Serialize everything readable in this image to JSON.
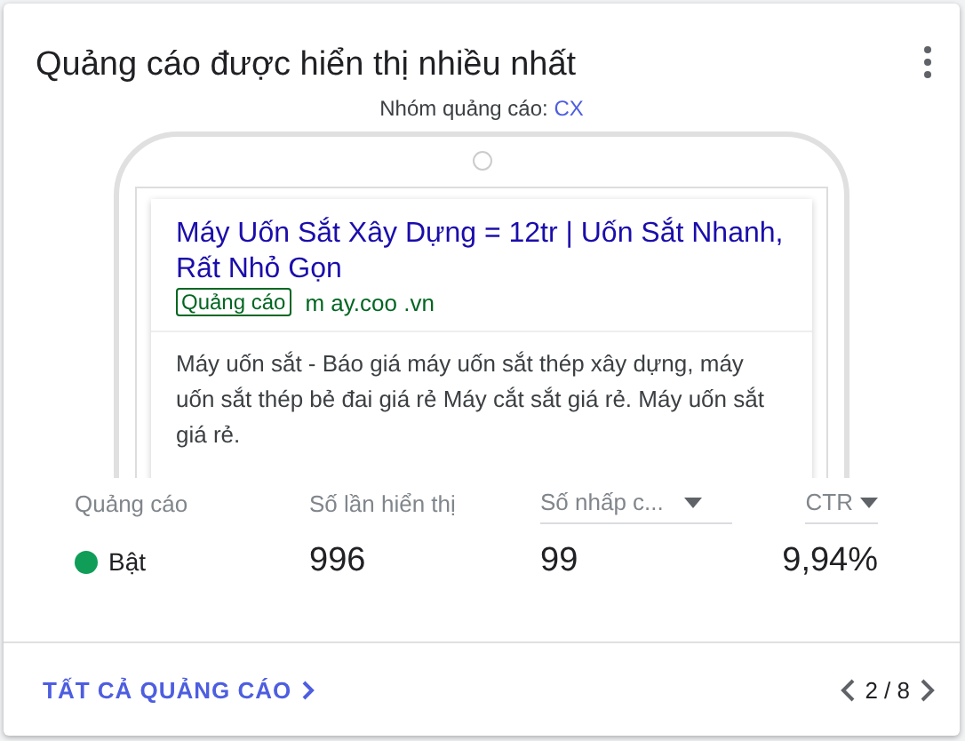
{
  "card": {
    "title": "Quảng cáo được hiển thị nhiều nhất",
    "ad_group": {
      "label": "Nhóm quảng cáo:",
      "value": "CX"
    },
    "ad_preview": {
      "headline": "Máy Uốn Sắt Xây Dựng = 12tr | Uốn Sắt Nhanh, Rất Nhỏ Gọn",
      "badge": "Quảng cáo",
      "url": "m ay.coo .vn",
      "description": "Máy uốn sắt - Báo giá máy uốn sắt thép xây dựng, máy uốn sắt thép bẻ đai giá rẻ Máy cắt sắt giá rẻ. Máy uốn sắt giá rẻ."
    },
    "table": {
      "columns": [
        {
          "label": "Quảng cáo",
          "sortable": false
        },
        {
          "label": "Số lần hiển thị",
          "sortable": false
        },
        {
          "label": "Số nhấp c...",
          "sortable": true
        },
        {
          "label": "CTR",
          "sortable": true
        }
      ],
      "row": {
        "status": {
          "label": "Bật",
          "color": "#0f9d58"
        },
        "values": [
          "996",
          "99",
          "9,94%"
        ]
      }
    },
    "footer": {
      "link": "TẤT CẢ QUẢNG CÁO",
      "page": "2 / 8"
    }
  }
}
